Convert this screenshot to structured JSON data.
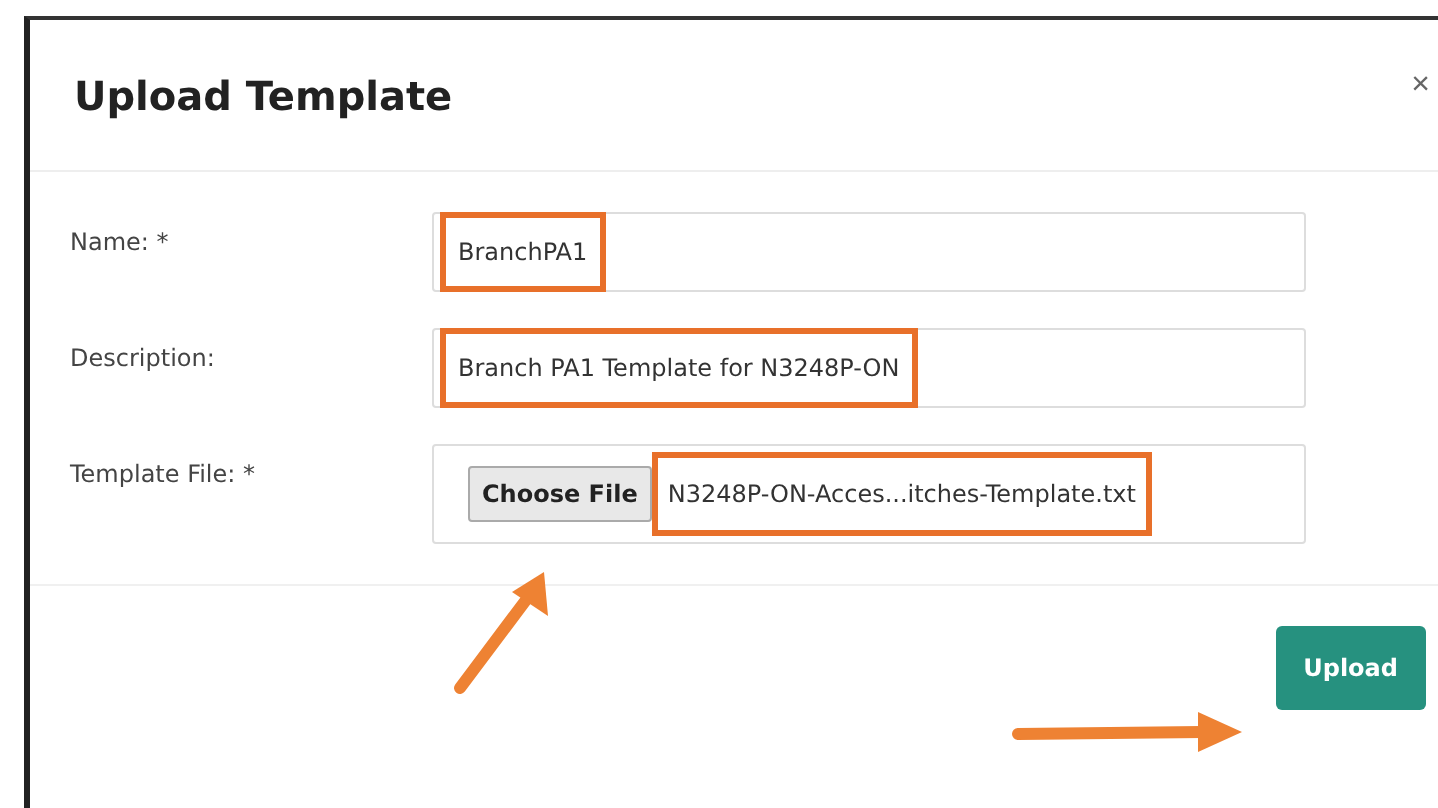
{
  "dialog": {
    "title": "Upload Template",
    "close": "×"
  },
  "fields": [
    {
      "kind": "text",
      "label": "Name: *",
      "value": "BranchPA1",
      "highlighted": true
    },
    {
      "kind": "text",
      "label": "Description:",
      "value": "Branch PA1 Template for N3248P-ON",
      "highlighted": true
    },
    {
      "kind": "file",
      "label": "Template File: *",
      "button": "Choose File",
      "value": "N3248P-ON-Acces...itches-Template.txt",
      "highlighted": true
    }
  ],
  "footer": {
    "button": "Upload"
  }
}
